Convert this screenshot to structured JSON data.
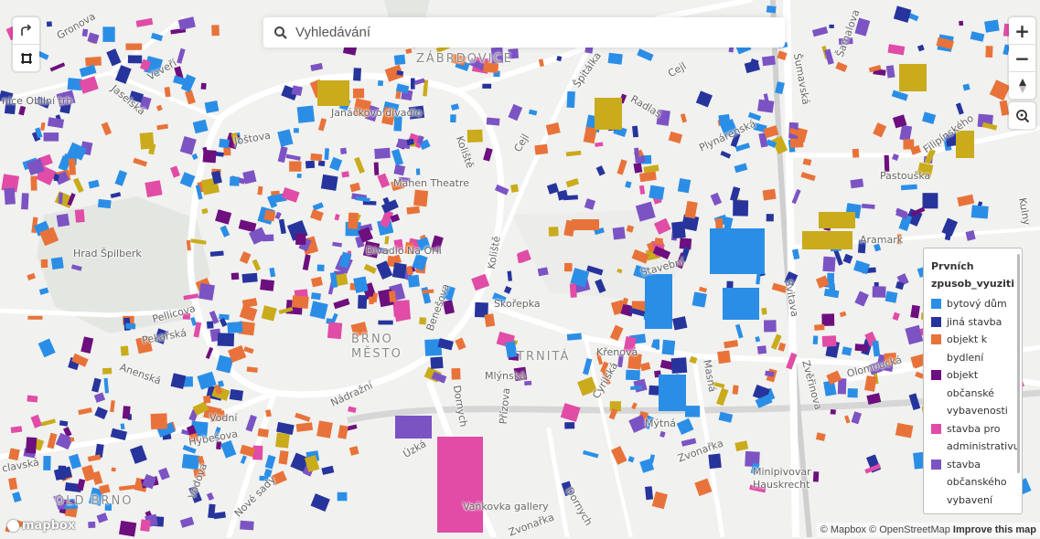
{
  "search": {
    "placeholder": "Vyhledávání"
  },
  "controls": {
    "zoom_in": "+",
    "zoom_out": "−",
    "compass": "▲"
  },
  "legend": {
    "title": "Prvních zpusob_vyuziti",
    "items": [
      {
        "label": "bytový dům",
        "color": "#2b8ee6"
      },
      {
        "label": "jiná stavba",
        "color": "#27349c"
      },
      {
        "label": "objekt k bydlení",
        "color": "#e8733a"
      },
      {
        "label": "objekt občanské vybavenosti",
        "color": "#6d0f7e"
      },
      {
        "label": "stavba pro administrativu",
        "color": "#e04ca6"
      },
      {
        "label": "stavba občanského vybavení",
        "color": "#7c53c3"
      }
    ]
  },
  "labels": {
    "zabrovice": "ZÁBRDOVICE",
    "janackovo": "Janáčkovo divadlo",
    "mahen": "Mahen Theatre",
    "divadlo_na_orli": "Divadlo Na Orli",
    "hrad": "Hrad Špilberk",
    "brno_mesto_1": "BRNO",
    "brno_mesto_2": "MĚSTO",
    "trnita": "TRNITÁ",
    "old_brno": "OLD BRNO",
    "obilni": "nice Obilní trh",
    "jostova": "Joštova",
    "pellicova": "Pellicova",
    "pekarska": "Pekařská",
    "anenska": "Anenská",
    "vodni": "Vodní",
    "hybesova": "Hybešova",
    "nove_sady": "Nové sady",
    "uzka": "Úzká",
    "dornych1": "Dornych",
    "dornych2": "Dornych",
    "nadrazni": "Nádražní",
    "benesova": "Benešova",
    "koliste1": "Koliště",
    "koliste2": "Koliště",
    "skorepka": "Skořepka",
    "krenova": "Křenová",
    "cyrilska": "Cyrilská",
    "prizova": "Přízova",
    "mytna": "Mýtná",
    "mlynska": "Mlýnská",
    "zvonarka1": "Zvonařka",
    "zvonarka2": "Zvonařka",
    "masna": "Masná",
    "zvlarova": "Zvěřinova",
    "olomoucka": "Olomoucká",
    "sumavska": "Šumavská",
    "svitava": "Svitava",
    "pastouska": "Pastouška",
    "aramark": "Aramark",
    "plynarenska": "Plynárenská",
    "radlas": "Radlas",
    "filipinskeho": "Filipínského",
    "cejl1": "Cejl",
    "cejl2": "Cejl",
    "stavebni": "Stavební",
    "vankovka": "Vaňkovka gallery",
    "minipivovar": "Minipivovar Hauskrecht",
    "kulny": "Kulny",
    "gronova": "Gronova",
    "veveri": "Veveří",
    "jaselska": "Jaselská",
    "claclavska": "clavská",
    "spitalka": "Špitálka",
    "samalova": "Šamalova",
    "vodova": "Vodova"
  },
  "attribution": {
    "mapbox": "© Mapbox",
    "osm": "© OpenStreetMap",
    "improve": "Improve this map"
  },
  "logo": {
    "text": "mapbox"
  },
  "building_colors": [
    "#2b8ee6",
    "#2b8ee6",
    "#2b8ee6",
    "#27349c",
    "#27349c",
    "#e8733a",
    "#e8733a",
    "#e8733a",
    "#6d0f7e",
    "#e04ca6",
    "#7c53c3",
    "#7c53c3",
    "#c9ab1c"
  ]
}
